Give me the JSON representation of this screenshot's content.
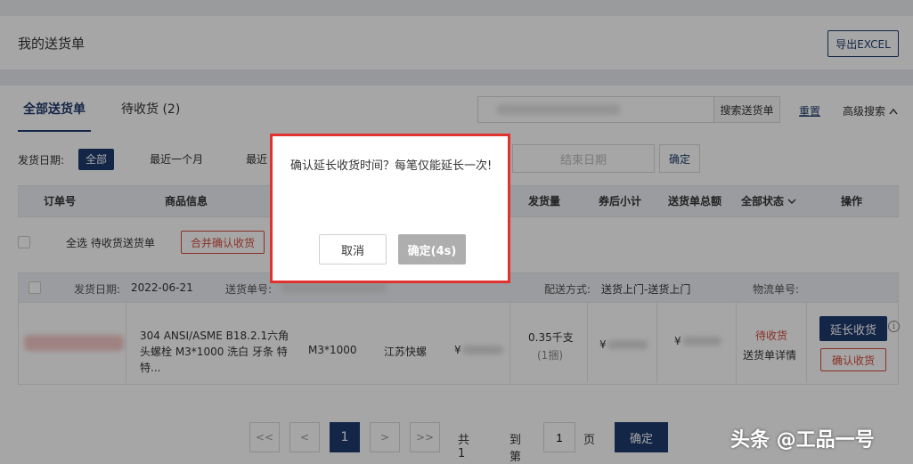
{
  "header": {
    "title": "我的送货单",
    "export_label": "导出EXCEL"
  },
  "tabs": [
    {
      "label": "全部送货单"
    },
    {
      "label": "待收货 (2)"
    }
  ],
  "search": {
    "button_label": "搜索送货单",
    "reset_label": "重置",
    "advanced_label": "高级搜索"
  },
  "date_filter": {
    "label": "发货日期:",
    "options": [
      "全部",
      "最近一个月",
      "最近"
    ],
    "end_placeholder": "结束日期",
    "confirm_label": "确定"
  },
  "table": {
    "columns": [
      "订单号",
      "商品信息",
      "发货量",
      "券后小计",
      "送货单总额",
      "全部状态",
      "操作"
    ]
  },
  "select_row": {
    "label": "全选 待收货送货单",
    "merge_button": "合并确认收货"
  },
  "order": {
    "ship_date_label": "发货日期:",
    "ship_date": "2022-06-21",
    "delivery_no_label": "送货单号:",
    "delivery_method_label": "配送方式:",
    "delivery_method": "送货上门-送货上门",
    "tracking_label": "物流单号:",
    "product_name": "304 ANSI/ASME B18.2.1六角头螺栓 M3*1000 洗白 牙条 特特...",
    "spec": "M3*1000",
    "brand": "江苏快螺",
    "price_symbol": "¥",
    "quantity": "0.35千支",
    "quantity_unit": "(1捆)",
    "subtotal_symbol": "¥",
    "total_symbol": "¥",
    "status": "待收货",
    "detail_link": "送货单详情",
    "extend_button": "延长收货",
    "info_icon": "i",
    "confirm_button": "确认收货"
  },
  "pagination": {
    "first": "<<",
    "prev": "<",
    "current": "1",
    "next": ">",
    "last": ">>",
    "total_text": "共1页",
    "goto_label": "到第",
    "goto_value": "1",
    "page_suffix": "页",
    "confirm_label": "确定"
  },
  "dialog": {
    "message": "确认延长收货时间？每笔仅能延长一次!",
    "cancel_label": "取消",
    "ok_label": "确定(4s)"
  },
  "watermark": "头条 @工品一号",
  "colors": {
    "primary": "#1f3b6e",
    "danger": "#d44a3a",
    "highlight_border": "#e0322e"
  }
}
